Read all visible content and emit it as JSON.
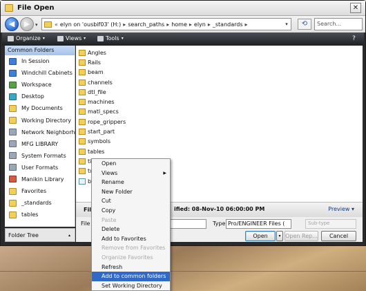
{
  "dialog": {
    "title": "File Open",
    "close_glyph": "✕"
  },
  "nav": {
    "back_glyph": "◀",
    "forward_glyph": "▶",
    "dropdown_glyph": "▾",
    "refresh_glyph": "⟲"
  },
  "address": {
    "chevrons": "«",
    "separator": "▸",
    "segments": [
      "elyn on 'ousbif03' (H:)",
      "search_paths",
      "home",
      "elyn",
      "_standards"
    ],
    "dropdown_glyph": "▾",
    "search_placeholder": "Search..."
  },
  "toolbar": {
    "organize": "Organize",
    "views": "Views",
    "tools": "Tools",
    "dropdown_glyph": "▾",
    "help_glyph": "?"
  },
  "sidebar": {
    "header": "Common Folders",
    "items": [
      {
        "label": "In Session",
        "icon": "in-session-icon",
        "color": "blue"
      },
      {
        "label": "Windchill Cabinets",
        "icon": "windchill-cabinets-icon",
        "color": "blue"
      },
      {
        "label": "Workspace",
        "icon": "workspace-icon",
        "color": "green"
      },
      {
        "label": "Desktop",
        "icon": "desktop-icon",
        "color": "cyan"
      },
      {
        "label": "My Documents",
        "icon": "my-documents-icon",
        "color": "folder"
      },
      {
        "label": "Working Directory",
        "icon": "working-directory-icon",
        "color": "folder"
      },
      {
        "label": "Network Neighborhood",
        "icon": "network-neighborhood-icon",
        "color": "gray"
      },
      {
        "label": "MFG LIBRARY",
        "icon": "mfg-library-icon",
        "color": "gray"
      },
      {
        "label": "System Formats",
        "icon": "system-formats-icon",
        "color": "gray"
      },
      {
        "label": "User Formats",
        "icon": "user-formats-icon",
        "color": "gray"
      },
      {
        "label": "Manikin Library",
        "icon": "manikin-library-icon",
        "color": "red"
      },
      {
        "label": "Favorites",
        "icon": "favorites-icon",
        "color": "folder"
      },
      {
        "label": "_standards",
        "icon": "folder-icon",
        "color": "folder"
      },
      {
        "label": "tables",
        "icon": "folder-icon",
        "color": "folder"
      }
    ],
    "footer_label": "Folder Tree",
    "footer_caret": "▴"
  },
  "files": [
    {
      "name": "Angles",
      "type": "folder"
    },
    {
      "name": "Rails",
      "type": "folder"
    },
    {
      "name": "beam",
      "type": "folder"
    },
    {
      "name": "channels",
      "type": "folder"
    },
    {
      "name": "dtl_file",
      "type": "folder"
    },
    {
      "name": "machines",
      "type": "folder"
    },
    {
      "name": "matl_specs",
      "type": "folder"
    },
    {
      "name": "rope_grippers",
      "type": "folder"
    },
    {
      "name": "start_part",
      "type": "folder"
    },
    {
      "name": "symbols",
      "type": "folder"
    },
    {
      "name": "tables",
      "type": "folder"
    },
    {
      "name": "title_blocks",
      "type": "folder"
    },
    {
      "name": "tu",
      "type": "folder"
    },
    {
      "name": "be",
      "type": "doc"
    }
  ],
  "details": {
    "file_label": "File",
    "modified": "ified: 08-Nov-10 06:00:00 PM",
    "preview_label": "Preview",
    "preview_caret": "▾"
  },
  "bottom": {
    "file_name_label": "File n",
    "file_name_value": "",
    "type_label": "Type",
    "type_value": "Pro/ENGINEER Files (",
    "subtype_label": "Sub-type",
    "subtype_value": "",
    "open_label": "Open",
    "open_dropdown_glyph": "▾",
    "open_rep_label": "Open Rep...",
    "cancel_label": "Cancel"
  },
  "context_menu": {
    "submenu_glyph": "▶",
    "items": [
      {
        "label": "Open",
        "state": "enabled"
      },
      {
        "label": "Views",
        "state": "enabled",
        "submenu": true
      },
      {
        "label": "Rename",
        "state": "enabled"
      },
      {
        "label": "New Folder",
        "state": "enabled"
      },
      {
        "label": "Cut",
        "state": "enabled"
      },
      {
        "label": "Copy",
        "state": "enabled"
      },
      {
        "label": "Paste",
        "state": "disabled"
      },
      {
        "label": "Delete",
        "state": "enabled"
      },
      {
        "label": "Add to Favorites",
        "state": "enabled"
      },
      {
        "label": "Remove from Favorites",
        "state": "disabled"
      },
      {
        "label": "Organize Favorites",
        "state": "disabled"
      },
      {
        "label": "Refresh",
        "state": "enabled"
      },
      {
        "label": "Add to common folders",
        "state": "highlighted"
      },
      {
        "label": "Set Working Directory",
        "state": "enabled"
      }
    ]
  },
  "colors": {
    "highlight": "#3169c6",
    "folder": "#f2cf5a",
    "toolbar": "#1d1f22"
  }
}
